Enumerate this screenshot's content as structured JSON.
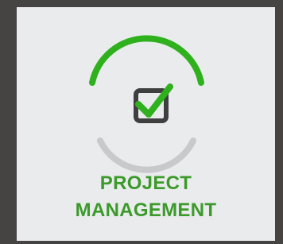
{
  "tile": {
    "label_line1": "PROJECT",
    "label_line2": "MANAGEMENT",
    "icon": "checkbox-check-icon",
    "colors": {
      "background": "#464343",
      "card": "#e9ebed",
      "accent_green": "#3c9a2a",
      "check_green": "#2fb11e",
      "arc_gray": "#c8c9cb",
      "box_dark": "#3f3f3f"
    }
  }
}
